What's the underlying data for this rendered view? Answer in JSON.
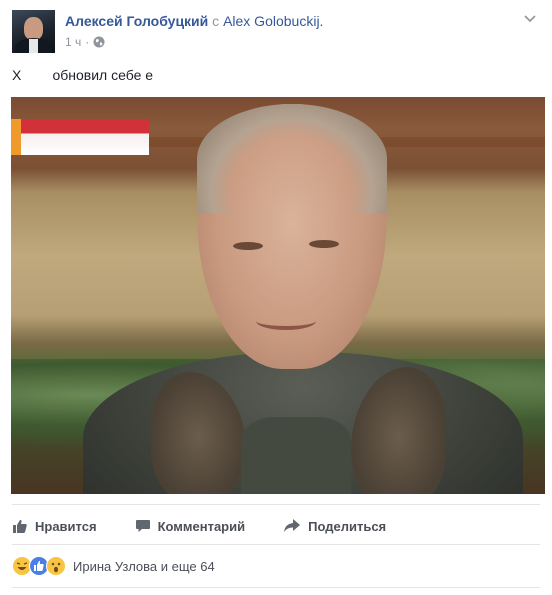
{
  "post": {
    "author_name": "Алексей Голобуцкий",
    "with_word": "с",
    "with_name": "Alex Golobuckij.",
    "time": "1 ч",
    "separator": "·",
    "text": "Х        обновил себе е"
  },
  "actions": {
    "like_label": "Нравится",
    "comment_label": "Комментарий",
    "share_label": "Поделиться"
  },
  "reactions": {
    "summary": "Ирина Узлова и еще 64",
    "icons": [
      "haha",
      "like",
      "wow"
    ]
  },
  "colors": {
    "link": "#365899",
    "meta": "#90949c",
    "action": "#4b4f56"
  }
}
